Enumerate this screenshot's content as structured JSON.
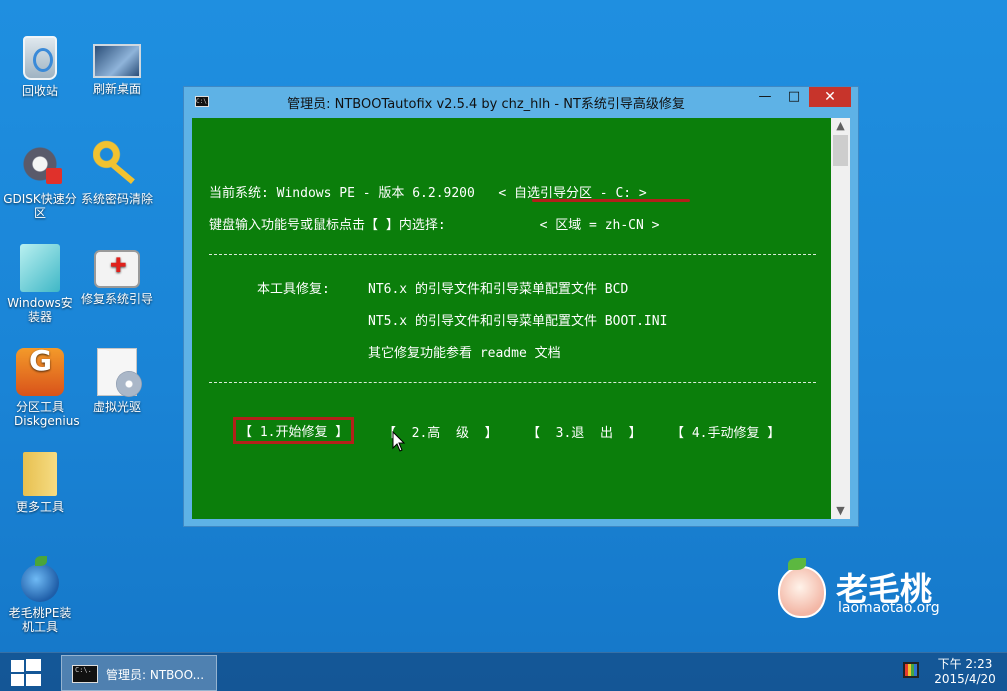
{
  "desktop": {
    "icons": [
      {
        "label": "回收站",
        "icon": "recycle-bin-icon"
      },
      {
        "label": "刷新桌面",
        "icon": "monitor-icon"
      },
      {
        "label": "GDISK快速分区",
        "icon": "gear-disk-icon"
      },
      {
        "label": "系统密码清除",
        "icon": "key-icon"
      },
      {
        "label": "Windows安装器",
        "icon": "windows-installer-icon"
      },
      {
        "label": "修复系统引导",
        "icon": "first-aid-kit-icon"
      },
      {
        "label": "分区工具Diskgenius",
        "icon": "diskgenius-icon"
      },
      {
        "label": "虚拟光驱",
        "icon": "virtual-disc-icon"
      },
      {
        "label": "更多工具",
        "icon": "folder-icon"
      },
      {
        "label": "老毛桃PE装机工具",
        "icon": "laomaotao-icon"
      }
    ]
  },
  "window": {
    "title": "管理员:  NTBOOTautofix v2.5.4 by chz_hlh - NT系统引导高级修复",
    "icon_text": "C:\\.",
    "minimize": "—",
    "maximize": "□",
    "close": "✕"
  },
  "console": {
    "line1": "当前系统: Windows PE - 版本 6.2.9200   < 自选引导分区 - C: >",
    "line2": "键盘输入功能号或鼠标点击【 】内选择:            < 区域 = zh-CN >",
    "repair_label": "本工具修复:",
    "repair1": "NT6.x 的引导文件和引导菜单配置文件 BCD",
    "repair2": "NT5.x 的引导文件和引导菜单配置文件 BOOT.INI",
    "repair3": "其它修复功能参看 readme 文档",
    "menu": [
      {
        "label": "【 1.开始修复 】",
        "active": true
      },
      {
        "label": "【  2.高  级  】",
        "active": false
      },
      {
        "label": "【  3.退  出  】",
        "active": false
      },
      {
        "label": "【 4.手动修复 】",
        "active": false
      }
    ],
    "colors": {
      "background": "#0b7e0b",
      "text": "#ffffff",
      "highlight": "#b3201a"
    }
  },
  "watermark": {
    "title": "老毛桃",
    "url": "laomaotao.org"
  },
  "taskbar": {
    "task_label": "管理员:  NTBOO...",
    "task_icon_text": "C:\\.",
    "time": "下午 2:23",
    "date": "2015/4/20"
  }
}
